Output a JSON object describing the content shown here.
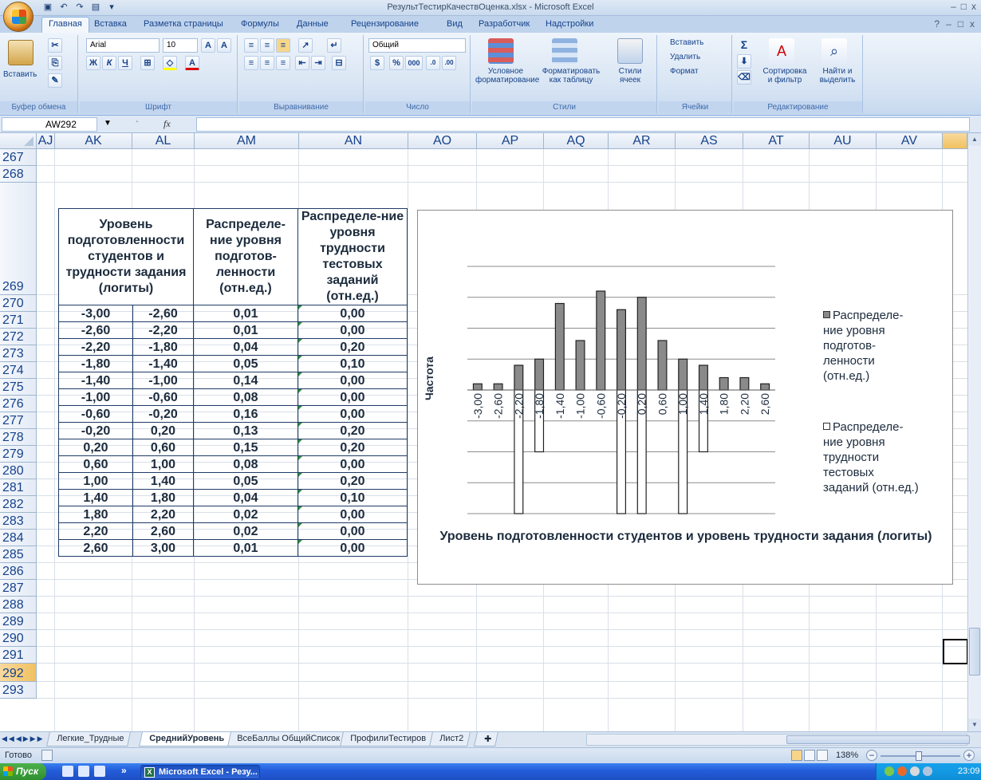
{
  "window": {
    "title": "РезультТестирКачествОценка.xlsx - Microsoft Excel",
    "controls": [
      "–",
      "□",
      "x"
    ]
  },
  "ribbon": {
    "tabs": [
      "Главная",
      "Вставка",
      "Разметка страницы",
      "Формулы",
      "Данные",
      "Рецензирование",
      "Вид",
      "Разработчик",
      "Надстройки"
    ],
    "clipboard": {
      "paste": "Вставить",
      "label": "Буфер обмена"
    },
    "font": {
      "name": "Arial",
      "size": "10",
      "label": "Шрифт",
      "bold": "Ж",
      "italic": "К",
      "underline": "Ч"
    },
    "alignment": {
      "label": "Выравнивание"
    },
    "number": {
      "format": "Общий",
      "percent": "%",
      "thousands": "000",
      "label": "Число"
    },
    "styles": {
      "conditional": "Условное форматирование",
      "table": "Форматировать как таблицу",
      "cell": "Стили ячеек",
      "label": "Стили"
    },
    "cells": {
      "insert": "Вставить",
      "delete": "Удалить",
      "format": "Формат",
      "label": "Ячейки"
    },
    "editing": {
      "sort": "Сортировка и фильтр",
      "find": "Найти и выделить",
      "label": "Редактирование",
      "sum": "Σ"
    }
  },
  "formula_bar": {
    "name_box": "AW292",
    "fx": "fx",
    "value": ""
  },
  "columns": [
    "AJ",
    "AK",
    "AL",
    "AM",
    "AN",
    "AO",
    "AP",
    "AQ",
    "AR",
    "AS",
    "AT",
    "AU",
    "AV"
  ],
  "rows": [
    "267",
    "268",
    "269",
    "270",
    "271",
    "272",
    "273",
    "274",
    "275",
    "276",
    "277",
    "278",
    "279",
    "280",
    "281",
    "282",
    "283",
    "284",
    "285",
    "286",
    "287",
    "288",
    "289",
    "290",
    "291",
    "292",
    "293"
  ],
  "table": {
    "headers": {
      "level": "Уровень подготовленности студентов и трудности задания (логиты)",
      "students": "Распределе-ние уровня подготов-ленности (отн.ед.)",
      "tasks": "Распределе-ние уровня трудности тестовых заданий (отн.ед.)"
    },
    "rows": [
      [
        "-3,00",
        "-2,60",
        "0,01",
        "0,00"
      ],
      [
        "-2,60",
        "-2,20",
        "0,01",
        "0,00"
      ],
      [
        "-2,20",
        "-1,80",
        "0,04",
        "0,20"
      ],
      [
        "-1,80",
        "-1,40",
        "0,05",
        "0,10"
      ],
      [
        "-1,40",
        "-1,00",
        "0,14",
        "0,00"
      ],
      [
        "-1,00",
        "-0,60",
        "0,08",
        "0,00"
      ],
      [
        "-0,60",
        "-0,20",
        "0,16",
        "0,00"
      ],
      [
        "-0,20",
        "0,20",
        "0,13",
        "0,20"
      ],
      [
        "0,20",
        "0,60",
        "0,15",
        "0,20"
      ],
      [
        "0,60",
        "1,00",
        "0,08",
        "0,00"
      ],
      [
        "1,00",
        "1,40",
        "0,05",
        "0,20"
      ],
      [
        "1,40",
        "1,80",
        "0,04",
        "0,10"
      ],
      [
        "1,80",
        "2,20",
        "0,02",
        "0,00"
      ],
      [
        "2,20",
        "2,60",
        "0,02",
        "0,00"
      ],
      [
        "2,60",
        "3,00",
        "0,01",
        "0,00"
      ]
    ]
  },
  "chart_data": {
    "type": "bar",
    "categories": [
      "-3,00",
      "-2,60",
      "-2,20",
      "-1,80",
      "-1,40",
      "-1,00",
      "-0,60",
      "-0,20",
      "0,20",
      "0,60",
      "1,00",
      "1,40",
      "1,80",
      "2,20",
      "2,60"
    ],
    "series": [
      {
        "name": "Распределе-ние уровня подготов-ленности (отн.ед.)",
        "values": [
          0.01,
          0.01,
          0.04,
          0.05,
          0.14,
          0.08,
          0.16,
          0.13,
          0.15,
          0.08,
          0.05,
          0.04,
          0.02,
          0.02,
          0.01
        ],
        "sign": 1,
        "color": "#8a8a8a"
      },
      {
        "name": "Распределе-ние уровня трудности тестовых заданий (отн.ед.)",
        "values": [
          0.0,
          0.0,
          0.2,
          0.1,
          0.0,
          0.0,
          0.0,
          0.2,
          0.2,
          0.0,
          0.2,
          0.1,
          0.0,
          0.0,
          0.0
        ],
        "sign": -1,
        "color": "#ffffff"
      }
    ],
    "xlabel": "Уровень подготовленности студентов и уровень трудности задания (логиты)",
    "ylabel": "Частота",
    "ylim": [
      -0.2,
      0.2
    ],
    "grid": true,
    "legend_position": "right"
  },
  "sheets": [
    "Легкие_Трудные",
    "СреднийУровень",
    "ВсеБаллы ОбщийСписок",
    "ПрофилиТестиров",
    "Лист2"
  ],
  "active_sheet": "СреднийУровень",
  "status": {
    "text": "Готово",
    "zoom": "138%"
  },
  "taskbar": {
    "start": "Пуск",
    "task": "Microsoft Excel - Резу...",
    "more": "»",
    "clock": "23:09"
  }
}
